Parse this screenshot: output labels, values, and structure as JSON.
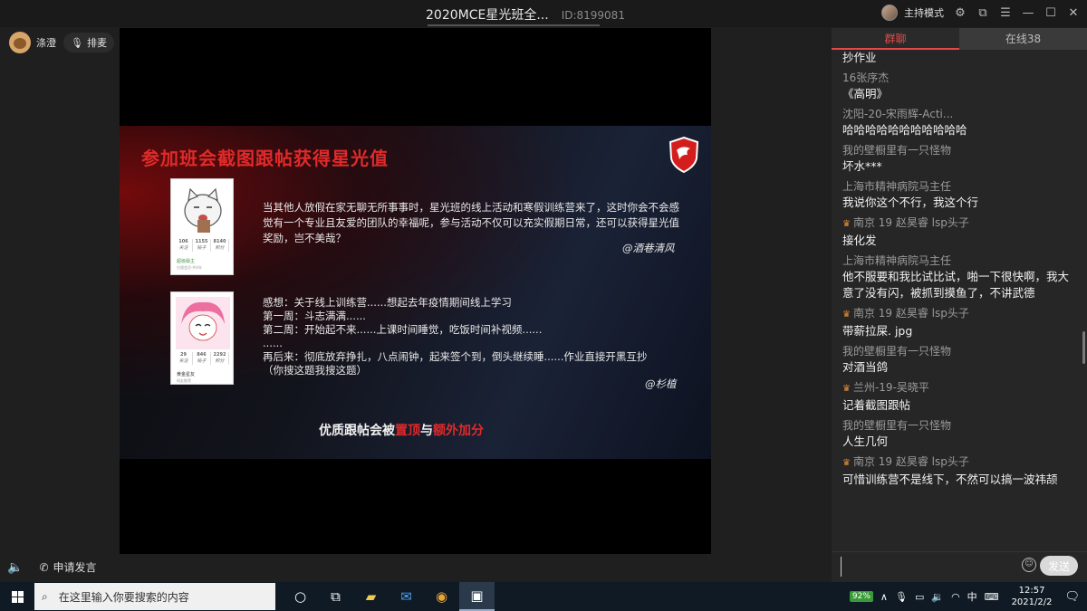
{
  "titlebar": {
    "title": "2020MCE星光班全...",
    "room_id": "ID:8199081",
    "host_mode": "主持模式",
    "icons": [
      "settings-icon",
      "popout-icon",
      "menu-icon",
      "minimize-icon",
      "maximize-icon",
      "close-icon"
    ]
  },
  "left": {
    "user_name": "涤澄",
    "queue_label": "排麦",
    "apply_label": "申请发言"
  },
  "slide": {
    "title": "参加班会截图跟帖获得星光值",
    "card1": {
      "stats": [
        "106",
        "1155",
        "8140"
      ],
      "stat_labels": [
        "关注",
        "帖子",
        "积分"
      ],
      "label": "超级版主",
      "sub": "白银会员·共4年"
    },
    "card2": {
      "stats": [
        "29",
        "846",
        "2292"
      ],
      "stat_labels": [
        "关注",
        "帖子",
        "积分"
      ],
      "label": "黄金星友",
      "sub": "网友推荐"
    },
    "paragraph1": "当其他人放假在家无聊无所事事时，星光班的线上活动和寒假训练营来了，这时你会不会感觉有一个专业且友爱的团队的幸福呢，参与活动不仅可以充实假期日常，还可以获得星光值奖励，岂不美哉？",
    "sig1": "@酒巷清风",
    "paragraph2_lines": [
      "感想：关于线上训练营......想起去年疫情期间线上学习",
      "第一周：斗志满满......",
      "第二周：开始起不来......上课时间睡觉，吃饭时间补视频......",
      "......",
      "再后来：彻底放弃挣扎，八点闹钟，起来签个到，倒头继续睡......作业直接开黑互抄",
      "（你搜这题我搜这题）"
    ],
    "sig2": "@杉植",
    "bottom": {
      "a": "优质跟帖会被",
      "b": "置顶",
      "c": "与",
      "d": "额外加分"
    }
  },
  "chat": {
    "tab_chat": "群聊",
    "tab_online": "在线38",
    "messages": [
      {
        "who": "",
        "text": "抄作业",
        "badge": false
      },
      {
        "who": "16张序杰",
        "text": "《高明》",
        "badge": false
      },
      {
        "who": "沈阳-20-宋雨辉-Acti...",
        "text": "哈哈哈哈哈哈哈哈哈哈哈",
        "badge": false
      },
      {
        "who": "我的壁橱里有一只怪物",
        "text": "坏水***",
        "badge": false
      },
      {
        "who": "上海市精神病院马主任",
        "text": "我说你这个不行，我这个行",
        "badge": false
      },
      {
        "who": "南京 19 赵昊睿 lsp头子",
        "text": "接化发",
        "badge": true
      },
      {
        "who": "上海市精神病院马主任",
        "text": "他不服要和我比试比试，啪一下很快啊，我大意了没有闪，被抓到摸鱼了，不讲武德",
        "badge": false
      },
      {
        "who": "南京 19 赵昊睿 lsp头子",
        "text": "带薪拉屎. jpg",
        "badge": true
      },
      {
        "who": "我的壁橱里有一只怪物",
        "text": "对酒当鸽",
        "badge": false
      },
      {
        "who": "兰州-19-吴晓平",
        "text": "记着截图跟帖",
        "badge": true
      },
      {
        "who": "我的壁橱里有一只怪物",
        "text": "人生几何",
        "badge": false
      },
      {
        "who": "南京 19 赵昊睿 lsp头子",
        "text": "可惜训练营不是线下，不然可以搞一波祎颉",
        "badge": true
      }
    ],
    "input_placeholder": "",
    "send_label": "发送"
  },
  "taskbar": {
    "search_placeholder": "在这里输入你要搜索的内容",
    "battery": "92%",
    "ime": "中",
    "time": "12:57",
    "date": "2021/2/2"
  }
}
